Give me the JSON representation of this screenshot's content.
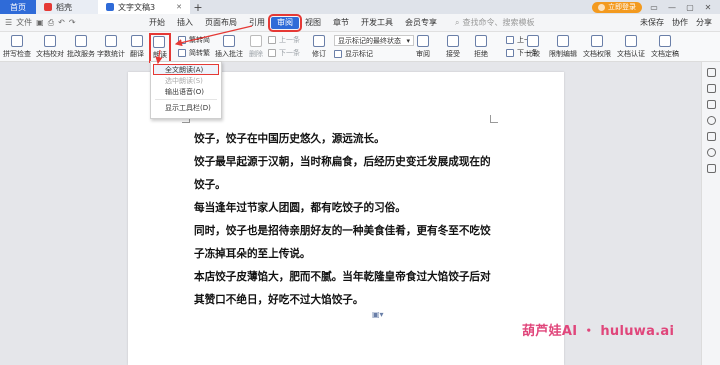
{
  "tabs": {
    "home": "首页",
    "template": "稻壳",
    "document": "文字文稿3",
    "new_tab": "+"
  },
  "account": {
    "login_button": "立即登录",
    "window_controls": [
      "▭",
      "—",
      "▢",
      "✕"
    ]
  },
  "menu": {
    "file": "文件",
    "items": [
      "开始",
      "插入",
      "页面布局",
      "引用",
      "审阅",
      "视图",
      "章节",
      "开发工具",
      "会员专享"
    ],
    "selected": "审阅",
    "search_placeholder": "查找命令、搜索模板",
    "right_items": [
      "未保存",
      "协作",
      "分享"
    ]
  },
  "ribbon": {
    "spell_check": "拼写检查",
    "doc_proof": "文档校对",
    "batch_review": "批改服务",
    "word_count": "字数统计",
    "translate": "翻译",
    "read_aloud": "朗读",
    "simp_trad_1": "繁转简",
    "simp_trad_2": "简转繁",
    "insert_comment": "插入批注",
    "delete": "删除",
    "prev": "上一条",
    "next": "下一条",
    "revise": "修订",
    "show_markup_select": "显示标记的最终状态",
    "show_markup": "显示标记",
    "prev2": "上一条",
    "next2": "下一条",
    "review": "审阅",
    "accept": "接受",
    "reject": "拒绝",
    "compare": "比较",
    "restrict_edit": "限制编辑",
    "doc_rights": "文档权限",
    "doc_cert": "文档认证",
    "doc_finalize": "文档定稿",
    "mode": "更多"
  },
  "dropdown": {
    "items": [
      "全文朗读(A)",
      "选中朗读(S)",
      "输出语音(O)",
      "显示工具栏(D)"
    ]
  },
  "document": {
    "lines": [
      "饺子，饺子在中国历史悠久，源远流长。",
      "饺子最早起源于汉朝，当时称扁食，后经历史变迁发展成现在的",
      "饺子。",
      "每当逢年过节家人团圆，都有吃饺子的习俗。",
      "同时，饺子也是招待亲朋好友的一种美食佳肴，更有冬至不吃饺",
      "子冻掉耳朵的至上传说。",
      "本店饺子皮薄馅大，肥而不腻。当年乾隆皇帝食过大馅饺子后对",
      "其赞口不绝日，好吃不过大馅饺子。"
    ]
  },
  "watermark": "葫芦娃AI ・ huluwa.ai",
  "colors": {
    "accent": "#2f6bd8",
    "highlight": "#e53935",
    "login": "#f39a1f",
    "watermark": "#e0467b"
  }
}
